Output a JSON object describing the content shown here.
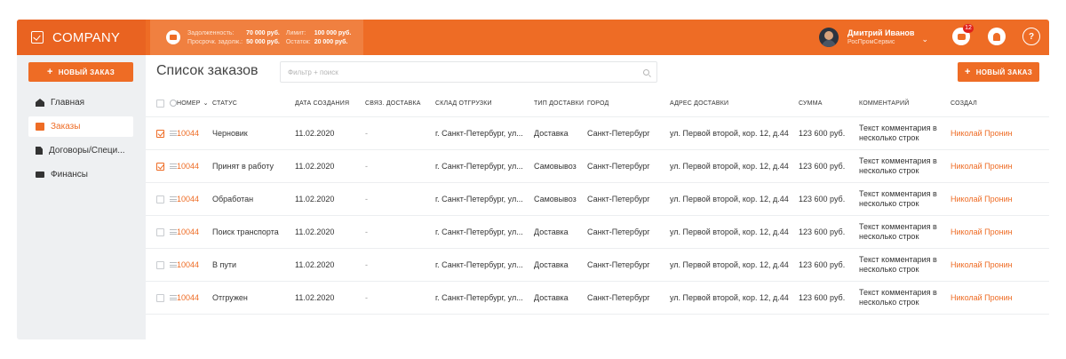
{
  "brand": {
    "name": "COMPANY"
  },
  "finance": {
    "debt_label": "Задолженность:",
    "debt_value": "70 000 руб.",
    "limit_label": "Лимит:",
    "limit_value": "100 000 руб.",
    "overdue_label": "Просрочк. задолж.:",
    "overdue_value": "50 000 руб.",
    "remain_label": "Остаток:",
    "remain_value": "20 000 руб."
  },
  "user": {
    "name": "Дмитрий Иванов",
    "org": "РосПромСервис",
    "caret": "⌄"
  },
  "notifications": {
    "chat_count": "12",
    "help_symbol": "?"
  },
  "sidebar": {
    "new_order_label": "НОВЫЙ ЗАКАЗ",
    "plus": "+",
    "items": [
      {
        "label": "Главная",
        "icon": "home-icon"
      },
      {
        "label": "Заказы",
        "icon": "orders-icon",
        "active": true
      },
      {
        "label": "Договоры/Специ...",
        "icon": "document-icon"
      },
      {
        "label": "Финансы",
        "icon": "card-icon"
      }
    ]
  },
  "main": {
    "title": "Список заказов",
    "filter_placeholder": "Фильтр + поиск",
    "new_order_label": "НОВЫЙ ЗАКАЗ",
    "plus": "+"
  },
  "table": {
    "headers": {
      "number": "НОМЕР",
      "status": "СТАТУС",
      "created": "ДАТА СОЗДАНИЯ",
      "linked": "СВЯЗ. ДОСТАВКА",
      "warehouse": "СКЛАД ОТГРУЗКИ",
      "delivery_type": "ТИП ДОСТАВКИ",
      "city": "ГОРОД",
      "address": "АДРЕС ДОСТАВКИ",
      "sum": "СУММА",
      "comment": "КОММЕНТАРИЙ",
      "creator": "СОЗДАЛ",
      "sort_caret": "⌄"
    },
    "rows": [
      {
        "number": "10044",
        "status": "Черновик",
        "created": "11.02.2020",
        "linked": "-",
        "warehouse": "г. Санкт-Петербург, ул...",
        "delivery_type": "Доставка",
        "city": "Санкт-Петербург",
        "address": "ул. Первой второй, кор. 12, д.44",
        "sum": "123 600 руб.",
        "comment": "Текст комментария в несколько строк",
        "creator": "Николай Пронин",
        "checked": true
      },
      {
        "number": "10044",
        "status": "Принят в работу",
        "created": "11.02.2020",
        "linked": "-",
        "warehouse": "г. Санкт-Петербург, ул...",
        "delivery_type": "Самовывоз",
        "city": "Санкт-Петербург",
        "address": "ул. Первой второй, кор. 12, д.44",
        "sum": "123 600 руб.",
        "comment": "Текст комментария в несколько строк",
        "creator": "Николай Пронин",
        "checked": true
      },
      {
        "number": "10044",
        "status": "Обработан",
        "created": "11.02.2020",
        "linked": "-",
        "warehouse": "г. Санкт-Петербург, ул...",
        "delivery_type": "Самовывоз",
        "city": "Санкт-Петербург",
        "address": "ул. Первой второй, кор. 12, д.44",
        "sum": "123 600 руб.",
        "comment": "Текст комментария в несколько строк",
        "creator": "Николай Пронин",
        "checked": false
      },
      {
        "number": "10044",
        "status": "Поиск транспорта",
        "created": "11.02.2020",
        "linked": "-",
        "warehouse": "г. Санкт-Петербург, ул...",
        "delivery_type": "Доставка",
        "city": "Санкт-Петербург",
        "address": "ул. Первой второй, кор. 12, д.44",
        "sum": "123 600 руб.",
        "comment": "Текст комментария в несколько строк",
        "creator": "Николай Пронин",
        "checked": false
      },
      {
        "number": "10044",
        "status": "В пути",
        "created": "11.02.2020",
        "linked": "-",
        "warehouse": "г. Санкт-Петербург, ул...",
        "delivery_type": "Доставка",
        "city": "Санкт-Петербург",
        "address": "ул. Первой второй, кор. 12, д.44",
        "sum": "123 600 руб.",
        "comment": "Текст комментария в несколько строк",
        "creator": "Николай Пронин",
        "checked": false
      },
      {
        "number": "10044",
        "status": "Отгружен",
        "created": "11.02.2020",
        "linked": "-",
        "warehouse": "г. Санкт-Петербург, ул...",
        "delivery_type": "Доставка",
        "city": "Санкт-Петербург",
        "address": "ул. Первой второй, кор. 12, д.44",
        "sum": "123 600 руб.",
        "comment": "Текст комментария в несколько строк",
        "creator": "Николай Пронин",
        "checked": false
      }
    ]
  },
  "colors": {
    "accent": "#ee6c25",
    "sidebar_bg": "#eef0f2",
    "badge": "#e0201b"
  }
}
